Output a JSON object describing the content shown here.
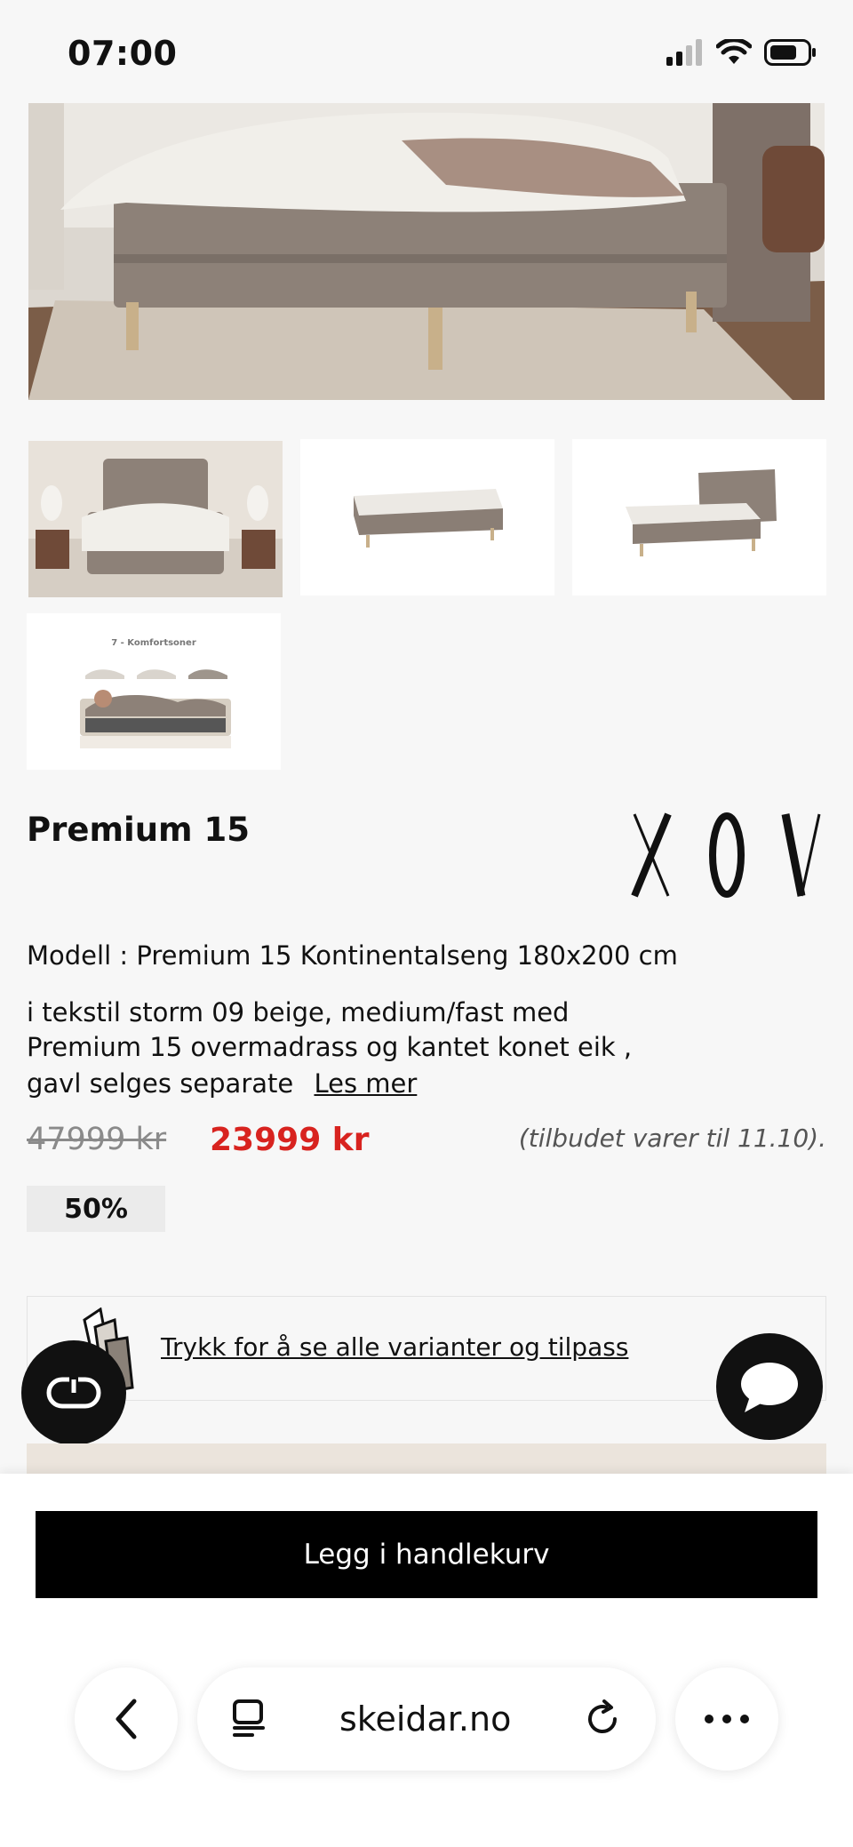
{
  "status_bar": {
    "time": "07:00"
  },
  "gallery": {
    "hero_alt": "bed-scene",
    "thumbnails": [
      {
        "name": "bedroom-scene"
      },
      {
        "name": "bed-no-headboard"
      },
      {
        "name": "bed-with-headboard"
      },
      {
        "name": "comfort-zones",
        "caption": "7 - Komfortsoner"
      }
    ]
  },
  "product": {
    "title": "Premium 15",
    "brand": "XOV",
    "model_line": "Modell : Premium 15 Kontinentalseng 180x200 cm",
    "description_lines": [
      "i tekstil storm 09 beige, medium/fast med",
      "Premium 15 overmadrass og kantet konet eik ,",
      "gavl selges separate"
    ],
    "read_more": "Les mer",
    "old_price": "47999 kr",
    "new_price": "23999 kr",
    "offer_note": "(tilbudet varer til 11.10).",
    "discount": "50%",
    "variants_link": "Trykk for å se alle varianter og tilpass"
  },
  "cart": {
    "add_label": "Legg i handlekurv"
  },
  "browser": {
    "url": "skeidar.no"
  },
  "colors": {
    "price_red": "#d8231f",
    "button_black": "#000000",
    "fabric_beige": "#8f8378"
  }
}
